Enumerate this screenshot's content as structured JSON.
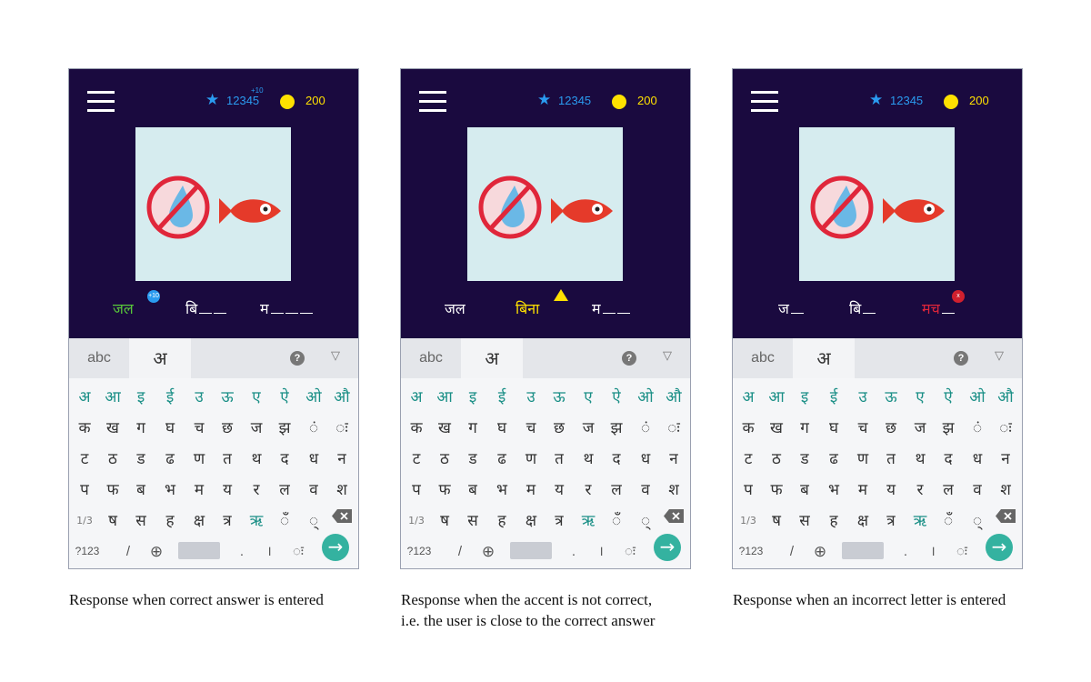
{
  "colors": {
    "game_background": "#1a0a3f",
    "score_blue": "#2a9bf0",
    "coin_yellow": "#ffe100",
    "correct_green": "#58c83a",
    "close_yellow": "#ffe100",
    "wrong_red": "#e0263a",
    "vowel_teal": "#1a8f86",
    "enter_teal": "#34b2a0"
  },
  "header": {
    "score": "12345",
    "score_delta": "+10",
    "coins": "200",
    "star_icon": "star-icon",
    "coin_icon": "coin-icon",
    "menu_icon": "hamburger-menu-icon"
  },
  "picture": {
    "icons": [
      "no-water-icon",
      "fish-icon"
    ]
  },
  "keyboard": {
    "tab_latin": "abc",
    "tab_hindi": "अ",
    "help": "?",
    "collapse": "▽",
    "vowels": [
      "अ",
      "आ",
      "इ",
      "ई",
      "उ",
      "ऊ",
      "ए",
      "ऐ",
      "ओ",
      "औ"
    ],
    "row2": [
      "क",
      "ख",
      "ग",
      "घ",
      "च",
      "छ",
      "ज",
      "झ",
      "ं",
      "ः"
    ],
    "row3": [
      "ट",
      "ठ",
      "ड",
      "ढ",
      "ण",
      "त",
      "थ",
      "द",
      "ध",
      "न"
    ],
    "row4": [
      "प",
      "फ",
      "ब",
      "भ",
      "म",
      "य",
      "र",
      "ल",
      "व",
      "श"
    ],
    "row5": [
      "ष",
      "स",
      "ह",
      "क्ष",
      "त्र",
      "ऋ",
      "ँ",
      "्"
    ],
    "shift": "1/3",
    "numbers": "?123",
    "slash": "/",
    "period": ".",
    "danda": "।",
    "colon": "ः",
    "enter": "→"
  },
  "panels": [
    {
      "word1": "जल",
      "word2": "बि",
      "word3": "म",
      "badge": "+10",
      "caption": "Response when correct answer is entered"
    },
    {
      "word1": "जल",
      "word2": "बिना",
      "word3": "म",
      "caption_line1": "Response when the accent is not correct,",
      "caption_line2": "i.e. the user is close to the correct answer"
    },
    {
      "word1": "ज",
      "word2": "बि",
      "word3": "मच",
      "badge": "x",
      "caption": "Response when an incorrect letter is entered"
    }
  ]
}
